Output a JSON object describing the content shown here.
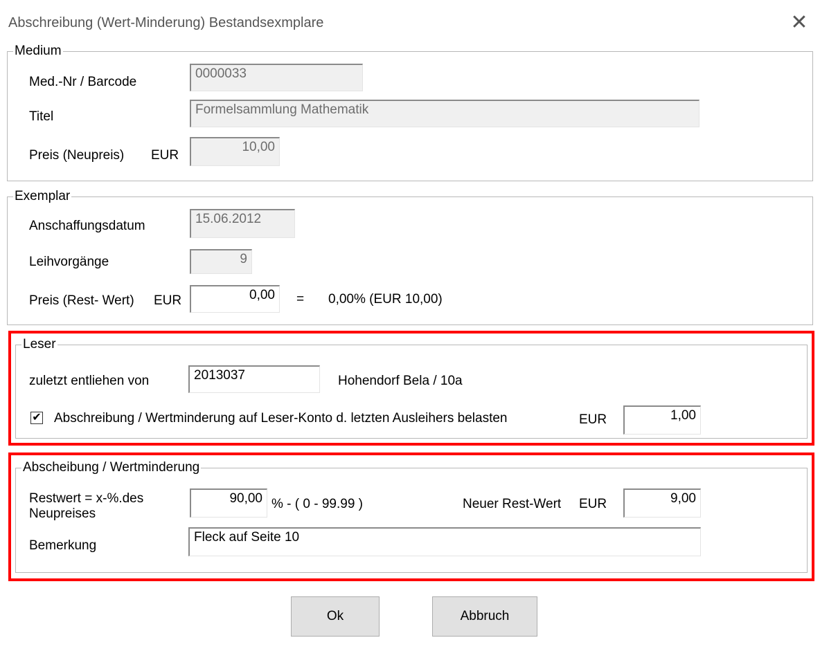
{
  "window": {
    "title": "Abschreibung (Wert-Minderung) Bestandsexmplare",
    "close_symbol": "✕"
  },
  "medium": {
    "legend": "Medium",
    "barcode_label": "Med.-Nr / Barcode",
    "barcode_value": "0000033",
    "title_label": "Titel",
    "title_value": "Formelsammlung Mathematik",
    "price_label": "Preis (Neupreis)",
    "currency": "EUR",
    "price_value": "10,00"
  },
  "exemplar": {
    "legend": "Exemplar",
    "date_label": "Anschaffungsdatum",
    "date_value": "15.06.2012",
    "loans_label": "Leihvorgänge",
    "loans_value": "9",
    "rest_label": "Preis (Rest- Wert)",
    "currency": "EUR",
    "rest_value": "0,00",
    "equals": "=",
    "percent_text": "0,00%  (EUR 10,00)"
  },
  "leser": {
    "legend": "Leser",
    "last_borrowed_label": "zuletzt entliehen von",
    "reader_id": "2013037",
    "reader_name": "Hohendorf Bela / 10a",
    "charge_checked": true,
    "check_mark": "✔",
    "charge_label": "Abschreibung / Wertminderung auf Leser-Konto d. letzten Ausleihers belasten",
    "currency": "EUR",
    "charge_value": "1,00"
  },
  "abschreibung": {
    "legend": "Abscheibung / Wertminderung",
    "restwert_label_line1": "Restwert = x-%.des",
    "restwert_label_line2": "Neupreises",
    "percent_value": "90,00",
    "range_text": "%  -  ( 0 - 99.99  )",
    "new_rest_label": "Neuer Rest-Wert",
    "currency": "EUR",
    "new_rest_value": "9,00",
    "remark_label": "Bemerkung",
    "remark_value": "Fleck auf Seite 10"
  },
  "buttons": {
    "ok": "Ok",
    "cancel": "Abbruch"
  },
  "colors": {
    "highlight": "#ff0000",
    "button_face": "#e1e1e1"
  }
}
